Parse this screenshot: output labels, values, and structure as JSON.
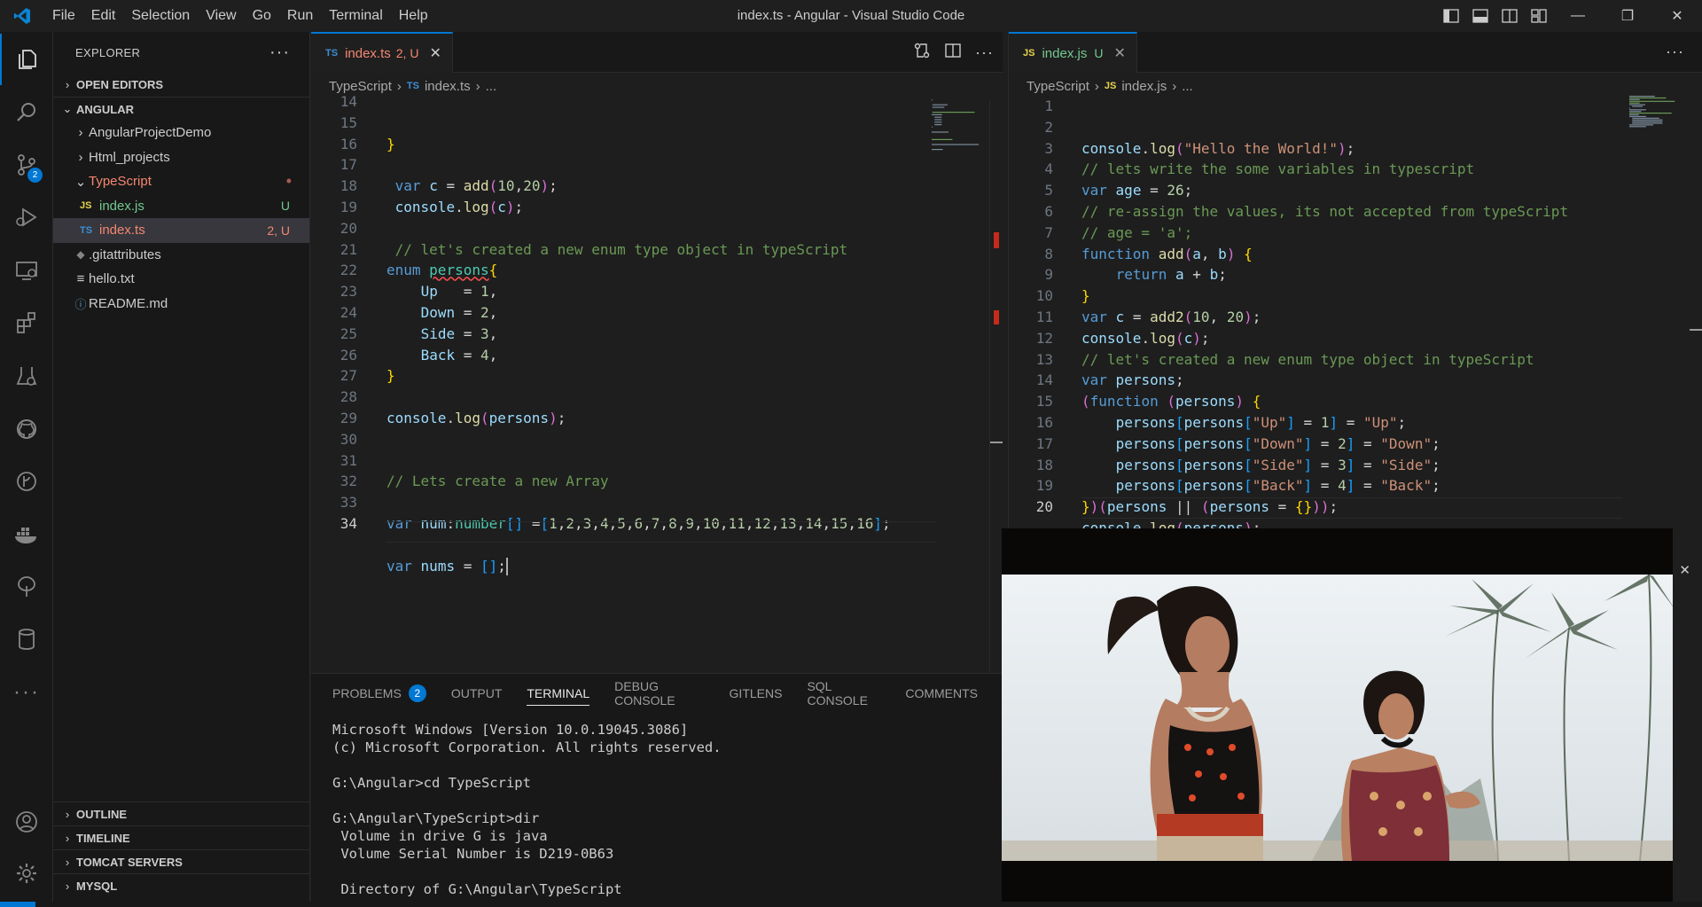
{
  "window": {
    "title": "index.ts - Angular - Visual Studio Code",
    "menu": [
      "File",
      "Edit",
      "Selection",
      "View",
      "Go",
      "Run",
      "Terminal",
      "Help"
    ]
  },
  "activity_bar": {
    "items": [
      "explorer-icon",
      "search-icon",
      "source-control-icon",
      "run-debug-icon",
      "remote-explorer-icon",
      "extensions-icon",
      "testing-icon",
      "github-icon",
      "git-graph-icon",
      "docker-icon",
      "tree-icon",
      "database-icon",
      "more-icon"
    ],
    "source_control_badge": "2"
  },
  "sidebar": {
    "title": "EXPLORER",
    "sections": {
      "open_editors": "OPEN EDITORS",
      "project": "ANGULAR"
    },
    "tree": [
      {
        "label": "AngularProjectDemo",
        "type": "folder",
        "status": ""
      },
      {
        "label": "Html_projects",
        "type": "folder",
        "status": ""
      },
      {
        "label": "TypeScript",
        "type": "folder-open",
        "status": "•"
      },
      {
        "label": "index.js",
        "type": "js",
        "status": "U"
      },
      {
        "label": "index.ts",
        "type": "ts",
        "status": "2, U"
      },
      {
        "label": ".gitattributes",
        "type": "file",
        "status": ""
      },
      {
        "label": "hello.txt",
        "type": "file",
        "status": ""
      },
      {
        "label": "README.md",
        "type": "info",
        "status": ""
      }
    ],
    "bottom_sections": [
      "OUTLINE",
      "TIMELINE",
      "TOMCAT SERVERS",
      "MYSQL"
    ]
  },
  "editor_left": {
    "tab": {
      "icon": "TS",
      "name": "index.ts",
      "status": "2, U"
    },
    "breadcrumb": {
      "folder": "TypeScript",
      "icon": "TS",
      "file": "index.ts",
      "more": "..."
    },
    "line_numbers": [
      "14",
      "15",
      "16",
      "17",
      "18",
      "19",
      "20",
      "21",
      "22",
      "23",
      "24",
      "25",
      "26",
      "27",
      "28",
      "29",
      "30",
      "31",
      "32",
      "33",
      "34"
    ],
    "lines": [
      "}",
      "",
      " var c = add(10,20);",
      " console.log(c);",
      "",
      " // let's created a new enum type object in typeScript",
      "enum persons{",
      "    Up   = 1,",
      "    Down = 2,",
      "    Side = 3,",
      "    Back = 4,",
      "}",
      "",
      "console.log(persons);",
      "",
      "",
      "// Lets create a new Array",
      "",
      "var num:number[] =[1,2,3,4,5,6,7,8,9,10,11,12,13,14,15,16];",
      "",
      "var nums = [];"
    ]
  },
  "panel": {
    "tabs": [
      "PROBLEMS",
      "OUTPUT",
      "TERMINAL",
      "DEBUG CONSOLE",
      "GITLENS",
      "SQL CONSOLE",
      "COMMENTS"
    ],
    "problems_count": "2",
    "active_tab": "TERMINAL",
    "terminal_lines": [
      "Microsoft Windows [Version 10.0.19045.3086]",
      "(c) Microsoft Corporation. All rights reserved.",
      "",
      "G:\\Angular>cd TypeScript",
      "",
      "G:\\Angular\\TypeScript>dir",
      " Volume in drive G is java",
      " Volume Serial Number is D219-0B63",
      "",
      " Directory of G:\\Angular\\TypeScript"
    ]
  },
  "editor_right": {
    "tab": {
      "icon": "JS",
      "name": "index.js",
      "status": "U"
    },
    "breadcrumb": {
      "folder": "TypeScript",
      "icon": "JS",
      "file": "index.js",
      "more": "..."
    },
    "line_numbers": [
      "1",
      "2",
      "3",
      "4",
      "5",
      "6",
      "7",
      "8",
      "9",
      "10",
      "11",
      "12",
      "13",
      "14",
      "15",
      "16",
      "17",
      "18",
      "19",
      "20"
    ],
    "lines": [
      "console.log(\"Hello the World!\");",
      "// lets write the some variables in typescript",
      "var age = 26;",
      "// re-assign the values, its not accepted from typeScript",
      "// age = 'a';",
      "function add(a, b) {",
      "    return a + b;",
      "}",
      "var c = add2(10, 20);",
      "console.log(c);",
      "// let's created a new enum type object in typeScript",
      "var persons;",
      "(function (persons) {",
      "    persons[persons[\"Up\"] = 1] = \"Up\";",
      "    persons[persons[\"Down\"] = 2] = \"Down\";",
      "    persons[persons[\"Side\"] = 3] = \"Side\";",
      "    persons[persons[\"Back\"] = 4] = \"Back\";",
      "})(persons || (persons = {}));",
      "console.log(persons);",
      ""
    ]
  },
  "colors": {
    "accent": "#0078d4",
    "background": "#1e1e1e",
    "sidebar": "#181818",
    "error": "#f14c4c",
    "ts_file": "#f48771",
    "js_file": "#73c991"
  }
}
